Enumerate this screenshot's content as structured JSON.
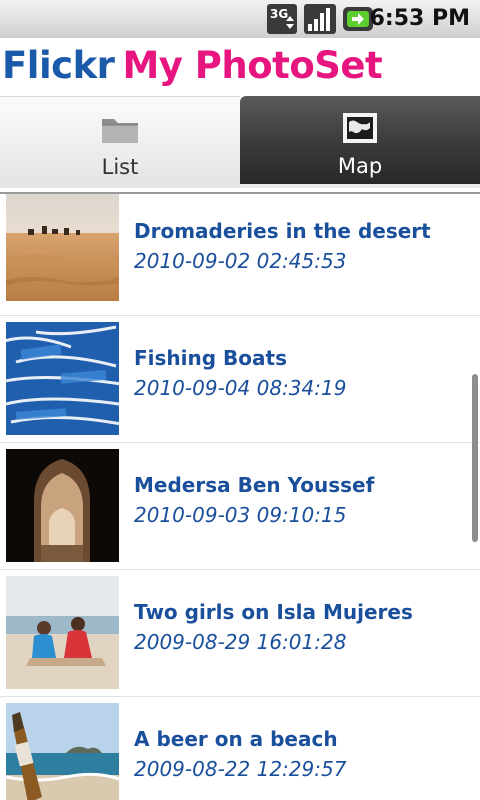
{
  "status_bar": {
    "network": "3G",
    "signal_icon": "signal-bars-icon",
    "battery_icon": "battery-icon",
    "time": "6:53 PM"
  },
  "app": {
    "title_part1": "Flickr",
    "title_part2": "My PhotoSet",
    "colors": {
      "primary": "#1a5aa8",
      "accent": "#e6157f",
      "item_text": "#1a4f9c"
    }
  },
  "tabs": [
    {
      "label": "List",
      "icon": "folder-icon",
      "selected": false
    },
    {
      "label": "Map",
      "icon": "map-icon",
      "selected": true
    }
  ],
  "photos": [
    {
      "title": "Dromaderies in the desert",
      "date": "2010-09-02 02:45:53"
    },
    {
      "title": "Fishing Boats",
      "date": "2010-09-04 08:34:19"
    },
    {
      "title": "Medersa Ben Youssef",
      "date": "2010-09-03 09:10:15"
    },
    {
      "title": "Two girls on Isla Mujeres",
      "date": "2009-08-29 16:01:28"
    },
    {
      "title": "A beer on a beach",
      "date": "2009-08-22 12:29:57"
    }
  ]
}
